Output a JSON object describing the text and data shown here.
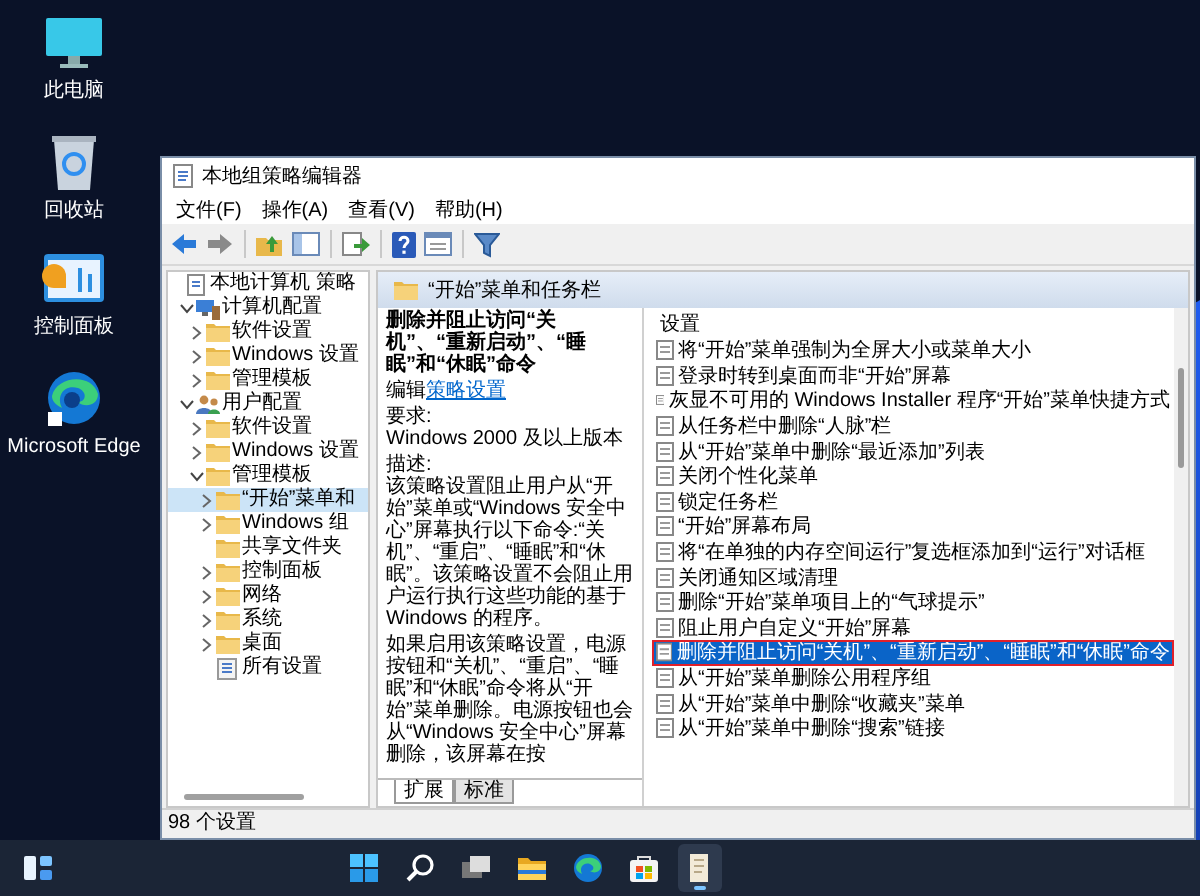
{
  "desktop_icons": [
    {
      "label": "此电脑",
      "kind": "pc"
    },
    {
      "label": "回收站",
      "kind": "bin"
    },
    {
      "label": "控制面板",
      "kind": "panel"
    },
    {
      "label": "Microsoft Edge",
      "kind": "edge"
    }
  ],
  "window": {
    "title": "本地组策略编辑器",
    "menu": [
      "文件(F)",
      "操作(A)",
      "查看(V)",
      "帮助(H)"
    ],
    "tree": {
      "label": "本地计算机 策略",
      "kind": "policy",
      "selected": false,
      "children": [
        {
          "label": "计算机配置",
          "kind": "computer",
          "expanded": true,
          "selected": false,
          "children": [
            {
              "label": "软件设置",
              "kind": "folder",
              "expanded": false,
              "selected": false
            },
            {
              "label": "Windows 设置",
              "kind": "folder",
              "expanded": false,
              "selected": false
            },
            {
              "label": "管理模板",
              "kind": "folder",
              "expanded": false,
              "selected": false
            }
          ]
        },
        {
          "label": "用户配置",
          "kind": "user",
          "expanded": true,
          "selected": false,
          "children": [
            {
              "label": "软件设置",
              "kind": "folder",
              "expanded": false,
              "selected": false
            },
            {
              "label": "Windows 设置",
              "kind": "folder",
              "expanded": false,
              "selected": false
            },
            {
              "label": "管理模板",
              "kind": "folder",
              "expanded": true,
              "selected": false,
              "children": [
                {
                  "label": "“开始”菜单和",
                  "kind": "folder",
                  "expanded": false,
                  "selected": true
                },
                {
                  "label": "Windows 组",
                  "kind": "folder",
                  "expanded": false,
                  "selected": false
                },
                {
                  "label": "共享文件夹",
                  "kind": "folder",
                  "selected": false
                },
                {
                  "label": "控制面板",
                  "kind": "folder",
                  "expanded": false,
                  "selected": false
                },
                {
                  "label": "网络",
                  "kind": "folder",
                  "expanded": false,
                  "selected": false
                },
                {
                  "label": "系统",
                  "kind": "folder",
                  "expanded": false,
                  "selected": false
                },
                {
                  "label": "桌面",
                  "kind": "folder",
                  "expanded": false,
                  "selected": false
                },
                {
                  "label": "所有设置",
                  "kind": "all",
                  "selected": false
                }
              ]
            }
          ]
        }
      ]
    },
    "folder_header": "“开始”菜单和任务栏",
    "detail": {
      "title": "删除并阻止访问“关机”、“重新启动”、“睡眠”和“休眠”命令",
      "edit_prefix": "编辑",
      "edit_link": "策略设置",
      "requirement_label": "要求:",
      "requirement": "Windows 2000 及以上版本",
      "description_label": "描述:",
      "paragraphs": [
        "该策略设置阻止用户从“开始”菜单或“Windows 安全中心”屏幕执行以下命令:“关机”、“重启”、“睡眠”和“休眠”。该策略设置不会阻止用户运行执行这些功能的基于 Windows 的程序。",
        "如果启用该策略设置，电源按钮和“关机”、“重启”、“睡眠”和“休眠”命令将从“开始”菜单删除。电源按钮也会从“Windows 安全中心”屏幕删除，该屏幕在按"
      ]
    },
    "view_tabs": [
      {
        "label": "扩展",
        "selected": true
      },
      {
        "label": "标准",
        "selected": false
      }
    ],
    "settings": {
      "column": "设置",
      "items": [
        {
          "label": "将“开始”菜单强制为全屏大小或菜单大小",
          "selected": false
        },
        {
          "label": "登录时转到桌面而非“开始”屏幕",
          "selected": false
        },
        {
          "label": "灰显不可用的 Windows Installer 程序“开始”菜单快捷方式",
          "selected": false
        },
        {
          "label": "从任务栏中删除“人脉”栏",
          "selected": false
        },
        {
          "label": "从“开始”菜单中删除“最近添加”列表",
          "selected": false
        },
        {
          "label": "关闭个性化菜单",
          "selected": false
        },
        {
          "label": "锁定任务栏",
          "selected": false
        },
        {
          "label": "“开始”屏幕布局",
          "selected": false
        },
        {
          "label": "将“在单独的内存空间运行”复选框添加到“运行”对话框",
          "selected": false
        },
        {
          "label": "关闭通知区域清理",
          "selected": false
        },
        {
          "label": "删除“开始”菜单项目上的“气球提示”",
          "selected": false
        },
        {
          "label": "阻止用户自定义“开始”屏幕",
          "selected": false
        },
        {
          "label": "删除并阻止访问“关机”、“重新启动”、“睡眠”和“休眠”命令",
          "selected": true
        },
        {
          "label": "从“开始”菜单删除公用程序组",
          "selected": false
        },
        {
          "label": "从“开始”菜单中删除“收藏夹”菜单",
          "selected": false
        },
        {
          "label": "从“开始”菜单中删除“搜索”链接",
          "selected": false
        }
      ]
    },
    "status_bar": "98 个设置"
  },
  "taskbar": {
    "items": [
      {
        "kind": "widgets",
        "active": false
      },
      {
        "kind": "start",
        "active": false
      },
      {
        "kind": "search",
        "active": false
      },
      {
        "kind": "taskview",
        "active": false
      },
      {
        "kind": "explorer",
        "active": false
      },
      {
        "kind": "edge",
        "active": false
      },
      {
        "kind": "store",
        "active": false
      },
      {
        "kind": "notepad",
        "active": true
      }
    ]
  }
}
